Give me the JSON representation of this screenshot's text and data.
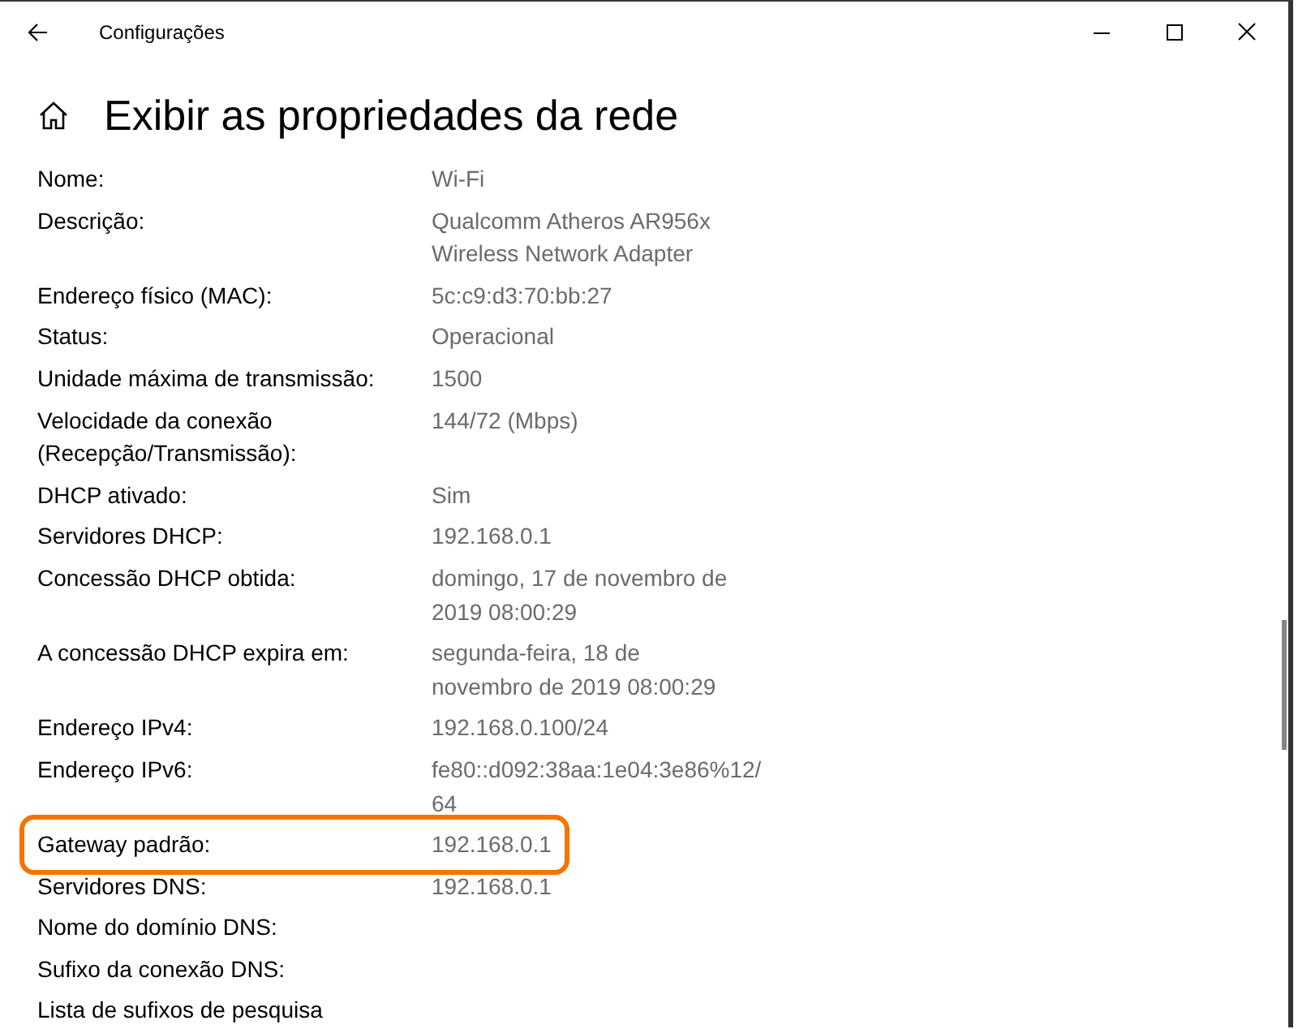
{
  "window": {
    "title": "Configurações"
  },
  "page": {
    "heading": "Exibir as propriedades da rede"
  },
  "properties": [
    {
      "label_lines": [
        "Nome:"
      ],
      "value_lines": [
        "Wi-Fi"
      ],
      "highlighted": false
    },
    {
      "label_lines": [
        "Descrição:"
      ],
      "value_lines": [
        "Qualcomm Atheros AR956x",
        "Wireless Network Adapter"
      ],
      "highlighted": false
    },
    {
      "label_lines": [
        "Endereço físico (MAC):"
      ],
      "value_lines": [
        "5c:c9:d3:70:bb:27"
      ],
      "highlighted": false
    },
    {
      "label_lines": [
        "Status:"
      ],
      "value_lines": [
        "Operacional"
      ],
      "highlighted": false
    },
    {
      "label_lines": [
        "Unidade máxima de transmissão:"
      ],
      "value_lines": [
        "1500"
      ],
      "highlighted": false
    },
    {
      "label_lines": [
        "Velocidade da conexão",
        "(Recepção/Transmissão):"
      ],
      "value_lines": [
        "144/72 (Mbps)"
      ],
      "highlighted": false
    },
    {
      "label_lines": [
        "DHCP ativado:"
      ],
      "value_lines": [
        "Sim"
      ],
      "highlighted": false
    },
    {
      "label_lines": [
        "Servidores DHCP:"
      ],
      "value_lines": [
        "192.168.0.1"
      ],
      "highlighted": false
    },
    {
      "label_lines": [
        "Concessão DHCP obtida:"
      ],
      "value_lines": [
        "domingo, 17 de novembro de",
        "2019 08:00:29"
      ],
      "highlighted": false
    },
    {
      "label_lines": [
        "A concessão DHCP expira em:"
      ],
      "value_lines": [
        "segunda-feira, 18 de",
        "novembro de 2019 08:00:29"
      ],
      "highlighted": false
    },
    {
      "label_lines": [
        "Endereço IPv4:"
      ],
      "value_lines": [
        "192.168.0.100/24"
      ],
      "highlighted": false
    },
    {
      "label_lines": [
        "Endereço IPv6:"
      ],
      "value_lines": [
        "fe80::d092:38aa:1e04:3e86%12/",
        "64"
      ],
      "highlighted": false
    },
    {
      "label_lines": [
        "Gateway padrão:"
      ],
      "value_lines": [
        "192.168.0.1"
      ],
      "highlighted": true
    },
    {
      "label_lines": [
        "Servidores DNS:"
      ],
      "value_lines": [
        "192.168.0.1"
      ],
      "highlighted": false
    },
    {
      "label_lines": [
        "Nome do domínio DNS:"
      ],
      "highlighted": false
    },
    {
      "label_lines": [
        "Sufixo da conexão DNS:"
      ],
      "highlighted": false
    },
    {
      "label_lines": [
        "Lista de sufixos de pesquisa"
      ],
      "highlighted": false
    }
  ]
}
